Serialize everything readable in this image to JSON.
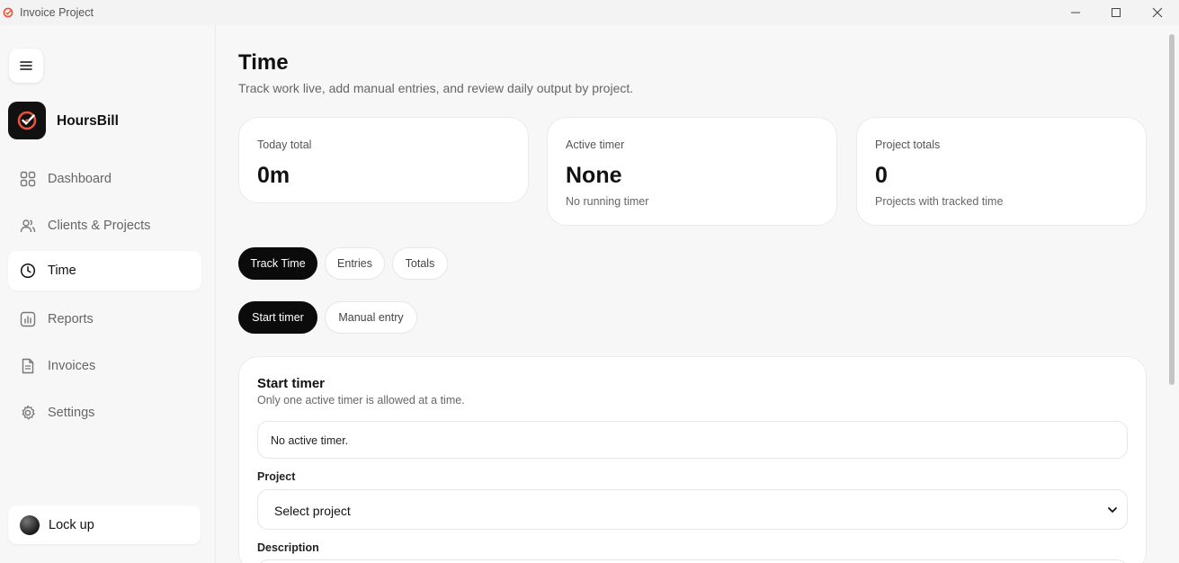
{
  "window": {
    "title": "Invoice Project"
  },
  "sidebar": {
    "brand": "HoursBill",
    "items": [
      {
        "label": "Dashboard",
        "icon": "grid-icon",
        "active": false
      },
      {
        "label": "Clients & Projects",
        "icon": "users-icon",
        "active": false
      },
      {
        "label": "Time",
        "icon": "clock-icon",
        "active": true
      },
      {
        "label": "Reports",
        "icon": "bar-chart-icon",
        "active": false
      },
      {
        "label": "Invoices",
        "icon": "document-icon",
        "active": false
      },
      {
        "label": "Settings",
        "icon": "gear-icon",
        "active": false
      }
    ],
    "lock_label": "Lock up"
  },
  "page": {
    "title": "Time",
    "subtitle": "Track work live, add manual entries, and review daily output by project."
  },
  "stats": [
    {
      "label": "Today total",
      "value": "0m",
      "note": ""
    },
    {
      "label": "Active timer",
      "value": "None",
      "note": "No running timer"
    },
    {
      "label": "Project totals",
      "value": "0",
      "note": "Projects with tracked time"
    }
  ],
  "tabs": [
    {
      "label": "Track Time",
      "active": true
    },
    {
      "label": "Entries",
      "active": false
    },
    {
      "label": "Totals",
      "active": false
    }
  ],
  "modes": [
    {
      "label": "Start timer",
      "active": true
    },
    {
      "label": "Manual entry",
      "active": false
    }
  ],
  "panel": {
    "title": "Start timer",
    "subtitle": "Only one active timer is allowed at a time.",
    "status": "No active timer.",
    "project_label": "Project",
    "project_value": "Select project",
    "description_label": "Description"
  },
  "colors": {
    "accent": "#0b0b0b",
    "brand_logo_bg": "#111111",
    "brand_logo_mark": "#e8533a",
    "background": "#f7f7f8"
  }
}
